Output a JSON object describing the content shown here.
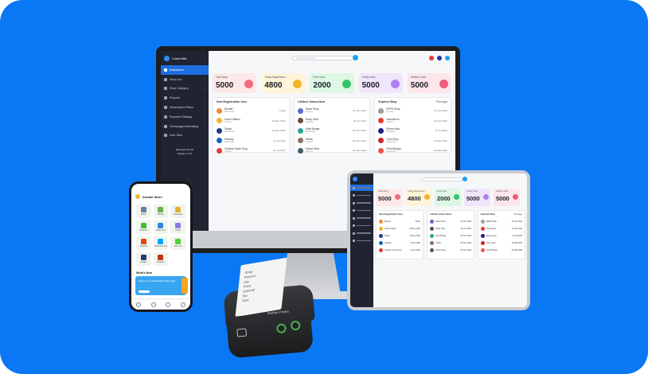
{
  "desktop": {
    "brand": "CoderHills",
    "search_placeholder": "Search Everything",
    "sidebar": [
      {
        "label": "Dashboard",
        "active": true
      },
      {
        "label": "Shop List"
      },
      {
        "label": "Shop Category"
      },
      {
        "label": "Reports"
      },
      {
        "label": "Subscription Plans"
      },
      {
        "label": "Payment Settings"
      },
      {
        "label": "Homepage Advertising"
      },
      {
        "label": "User Role"
      }
    ],
    "footer": [
      "Ecompos V2.4.0",
      "Version: 1.0.0"
    ],
    "stats": [
      {
        "label": "Total Shop",
        "value": "5000",
        "bg": "#fde8e8",
        "badge": "#f06b7b"
      },
      {
        "label": "Today Registration",
        "value": "4800",
        "bg": "#fff4d9",
        "badge": "#f3b52b"
      },
      {
        "label": "Free Uses",
        "value": "2000",
        "bg": "#def7e4",
        "badge": "#34c36a"
      },
      {
        "label": "Yearly Uses",
        "value": "5000",
        "bg": "#efe6fb",
        "badge": "#b07ff0"
      },
      {
        "label": "Lifetime Uses",
        "value": "5000",
        "bg": "#fde6ea",
        "badge": "#f05a7e"
      }
    ],
    "panels": {
      "new_registration": {
        "title": "New Registration User",
        "rows": [
          {
            "name": "Burnett",
            "sub": "Restaurant",
            "date": "Today",
            "color": "#f08a3a"
          },
          {
            "name": "Grand Station",
            "sub": "Grocery",
            "date": "19 Dec 2022",
            "color": "#f3b52b"
          },
          {
            "name": "Shopo",
            "sub": "Electronics",
            "date": "19 Dec 2022",
            "color": "#1e3a8a"
          },
          {
            "name": "Subway",
            "sub": "Fast Food",
            "date": "22 Jul 2022",
            "color": "#1565c0"
          },
          {
            "name": "Gulshan Super King",
            "sub": "Grocery",
            "date": "22 Jul 2022",
            "color": "#e53935"
          }
        ]
      },
      "lifetime_subscribed": {
        "title": "Lifetime Subscribed",
        "rows": [
          {
            "name": "Name Shop",
            "sub": "Grocery",
            "date": "01 Nov 2022",
            "color": "#5c6bc0"
          },
          {
            "name": "Henly Store",
            "sub": "Clothing",
            "date": "29 Jun 2022",
            "color": "#6d4c41"
          },
          {
            "name": "Hotel Burger",
            "sub": "Restaurant",
            "date": "01 Nov 2022",
            "color": "#26a69a"
          },
          {
            "name": "Yellow",
            "sub": "Fashion",
            "date": "01 Nov 2022",
            "color": "#8d6e63"
          },
          {
            "name": "Kamal Store",
            "sub": "Grocery",
            "date": "01 Nov 2022",
            "color": "#455a64"
          }
        ]
      },
      "expired_shop": {
        "title": "Expired Shop",
        "right": "Package",
        "rows": [
          {
            "name": "ERPD Shop",
            "sub": "Grocery",
            "date": "30 Jun 2022",
            "color": "#9e9e9e"
          },
          {
            "name": "Hamzarium",
            "sub": "Fashion",
            "date": "12 Sep 2022",
            "color": "#e53935"
          },
          {
            "name": "Shoes shop",
            "sub": "Footwear",
            "date": "12 Jul 2022",
            "color": "#1a237e"
          },
          {
            "name": "Chef Shop",
            "sub": "Restaurant",
            "date": "16 Mar 2022",
            "color": "#c62828"
          },
          {
            "name": "Fresh Burger",
            "sub": "Fast Food",
            "date": "20 Mar 2022",
            "color": "#ef5350"
          }
        ]
      }
    }
  },
  "tablet": {
    "stats": [
      {
        "label": "Total Shop",
        "value": "5000",
        "bg": "#fde8e8",
        "badge": "#f06b7b"
      },
      {
        "label": "Today Registration",
        "value": "4800",
        "bg": "#fff4d9",
        "badge": "#f3b52b"
      },
      {
        "label": "Free Uses",
        "value": "2000",
        "bg": "#def7e4",
        "badge": "#34c36a"
      },
      {
        "label": "Yearly Uses",
        "value": "5000",
        "bg": "#efe6fb",
        "badge": "#b07ff0"
      },
      {
        "label": "Lifetime Uses",
        "value": "5000",
        "bg": "#fde6ea",
        "badge": "#f05a7e"
      }
    ],
    "panel_titles": [
      "New Registration User",
      "Lifetime Subscribed",
      "Expired Shop"
    ],
    "panel_right": "Package"
  },
  "phone": {
    "title": "Amaan Store",
    "tiles": [
      {
        "label": "Sales",
        "color": "#6d7f9a"
      },
      {
        "label": "Parties",
        "color": "#6ab04c"
      },
      {
        "label": "Purchase",
        "color": "#e1b12c"
      },
      {
        "label": "Products",
        "color": "#44bd32"
      },
      {
        "label": "Sales List",
        "color": "#2e86de"
      },
      {
        "label": "Stock",
        "color": "#8c7ae6"
      },
      {
        "label": "Reports",
        "color": "#e84118"
      },
      {
        "label": "Purchase List",
        "color": "#00a8ff"
      },
      {
        "label": "Due List",
        "color": "#4cd137"
      },
      {
        "label": "Ledger",
        "color": "#273c75"
      },
      {
        "label": "Reports",
        "color": "#c23616"
      }
    ],
    "whats_new": "What's New",
    "banner_text": "Select your Subscription Plan Now"
  },
  "printer": {
    "brand": "Mobile Printer",
    "paper_lines": [
      "Shop",
      "Product",
      "Qty",
      "Price",
      "Subtotal",
      "Tax",
      "Total"
    ]
  }
}
